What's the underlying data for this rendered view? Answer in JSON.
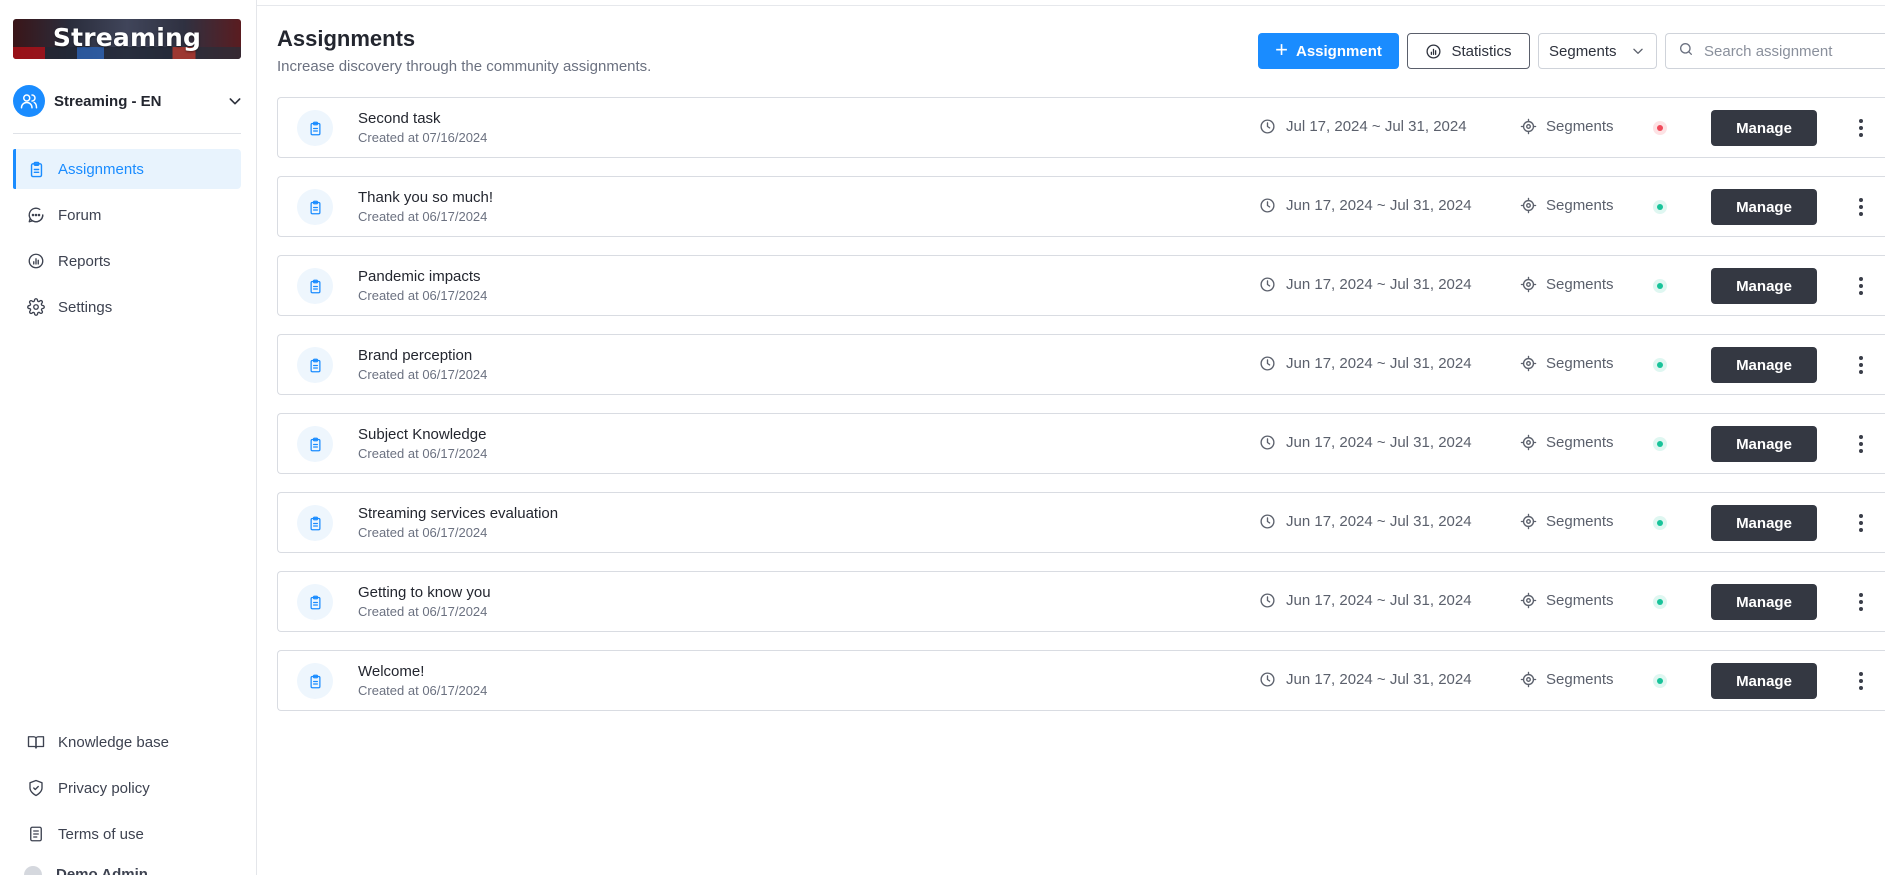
{
  "brand": {
    "title": "Streaming"
  },
  "workspace": {
    "name": "Streaming - EN"
  },
  "nav": {
    "items": [
      {
        "label": "Assignments",
        "icon": "clipboard-icon",
        "active": true
      },
      {
        "label": "Forum",
        "icon": "chat-icon",
        "active": false
      },
      {
        "label": "Reports",
        "icon": "chart-icon",
        "active": false
      },
      {
        "label": "Settings",
        "icon": "gear-icon",
        "active": false
      }
    ],
    "bottom": [
      {
        "label": "Knowledge base",
        "icon": "book-icon"
      },
      {
        "label": "Privacy policy",
        "icon": "shield-icon"
      },
      {
        "label": "Terms of use",
        "icon": "document-icon"
      }
    ],
    "user_partial": "Demo Admin"
  },
  "header": {
    "title": "Assignments",
    "subtitle": "Increase discovery through the community assignments.",
    "add_label": "Assignment",
    "stats_label": "Statistics",
    "segments_select": "Segments",
    "search_placeholder": "Search assignment"
  },
  "colors": {
    "accent": "#1a8cff",
    "dark_button": "#343842",
    "status_active": "#19c39a",
    "status_inactive": "#f04a5a"
  },
  "assignments": [
    {
      "name": "Second task",
      "created": "Created at 07/16/2024",
      "dates": "Jul 17, 2024 ~ Jul 31, 2024",
      "segments": "Segments",
      "status": "inactive",
      "action": "Manage"
    },
    {
      "name": "Thank you so much!",
      "created": "Created at 06/17/2024",
      "dates": "Jun 17, 2024 ~ Jul 31, 2024",
      "segments": "Segments",
      "status": "active",
      "action": "Manage"
    },
    {
      "name": "Pandemic impacts",
      "created": "Created at 06/17/2024",
      "dates": "Jun 17, 2024 ~ Jul 31, 2024",
      "segments": "Segments",
      "status": "active",
      "action": "Manage"
    },
    {
      "name": "Brand perception",
      "created": "Created at 06/17/2024",
      "dates": "Jun 17, 2024 ~ Jul 31, 2024",
      "segments": "Segments",
      "status": "active",
      "action": "Manage"
    },
    {
      "name": "Subject Knowledge",
      "created": "Created at 06/17/2024",
      "dates": "Jun 17, 2024 ~ Jul 31, 2024",
      "segments": "Segments",
      "status": "active",
      "action": "Manage"
    },
    {
      "name": "Streaming services evaluation",
      "created": "Created at 06/17/2024",
      "dates": "Jun 17, 2024 ~ Jul 31, 2024",
      "segments": "Segments",
      "status": "active",
      "action": "Manage"
    },
    {
      "name": "Getting to know you",
      "created": "Created at 06/17/2024",
      "dates": "Jun 17, 2024 ~ Jul 31, 2024",
      "segments": "Segments",
      "status": "active",
      "action": "Manage"
    },
    {
      "name": "Welcome!",
      "created": "Created at 06/17/2024",
      "dates": "Jun 17, 2024 ~ Jul 31, 2024",
      "segments": "Segments",
      "status": "active",
      "action": "Manage"
    }
  ]
}
